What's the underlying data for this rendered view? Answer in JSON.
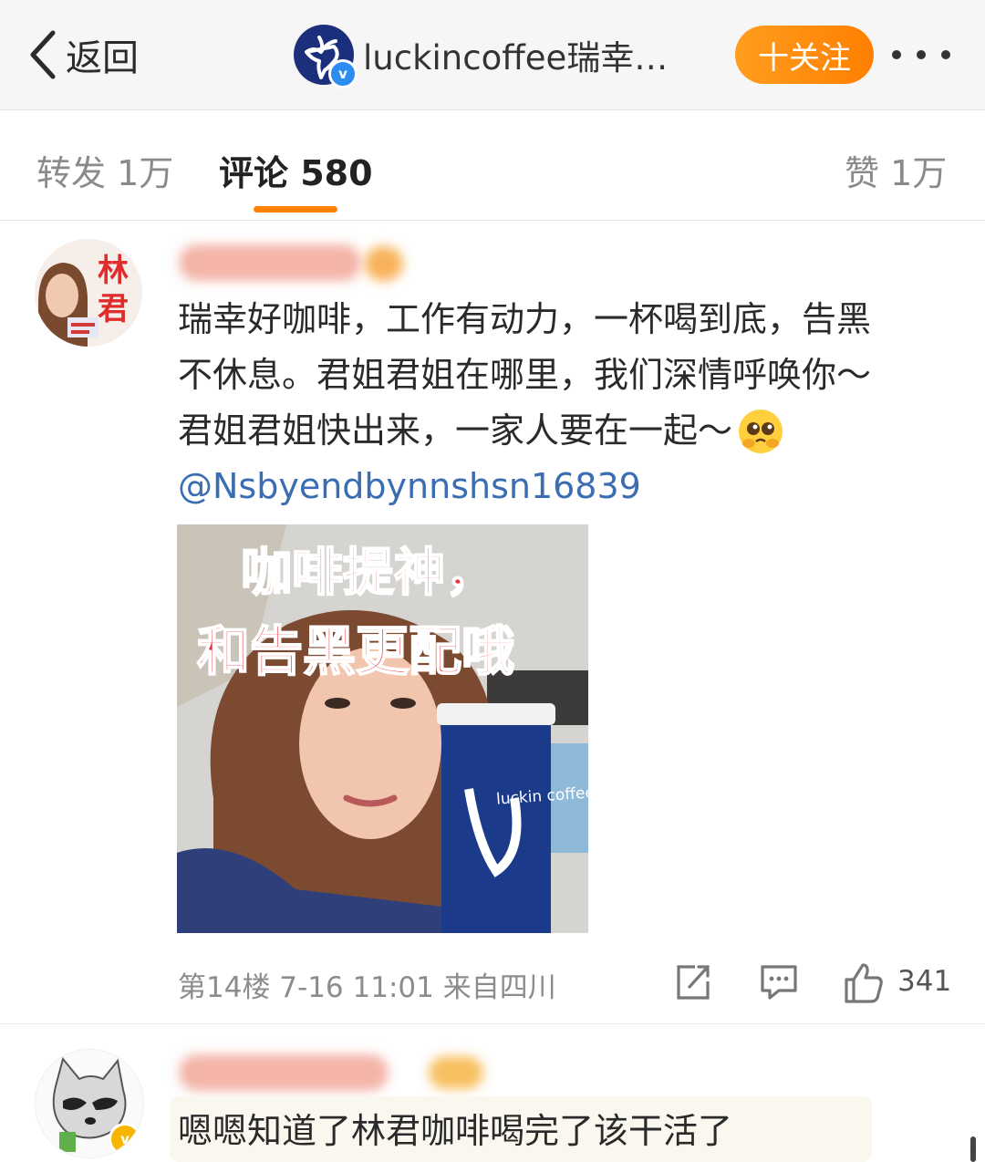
{
  "header": {
    "back_label": "返回",
    "account_name": "luckincoffee瑞幸…",
    "follow_label": "十关注",
    "more_icon": "more-dots-icon"
  },
  "tabs": [
    {
      "label": "转发 1万",
      "active": false
    },
    {
      "label": "评论 580",
      "active": true
    },
    {
      "label": "赞 1万",
      "active": false
    }
  ],
  "comments": [
    {
      "avatar_text": "林君",
      "lines": [
        "瑞幸好咖啡，工作有动力，一杯喝到底，告黑",
        "不休息。君姐君姐在哪里，我们深情呼唤你～",
        "君姐君姐快出来，一家人要在一起～"
      ],
      "mention": "@Nsbyendbynnshsn16839",
      "image_text_1": "咖啡提神，",
      "image_text_2": "和告黑更配哦",
      "cup_brand": "luckin coffee",
      "meta": "第14楼 7-16 11:01 来自四川",
      "like_count": "341"
    },
    {
      "text": "嗯嗯知道了林君咖啡喝完了该干活了"
    }
  ],
  "colors": {
    "accent": "#ff8200",
    "mention": "#3b6db3",
    "brand_blue": "#1b2f7c"
  }
}
